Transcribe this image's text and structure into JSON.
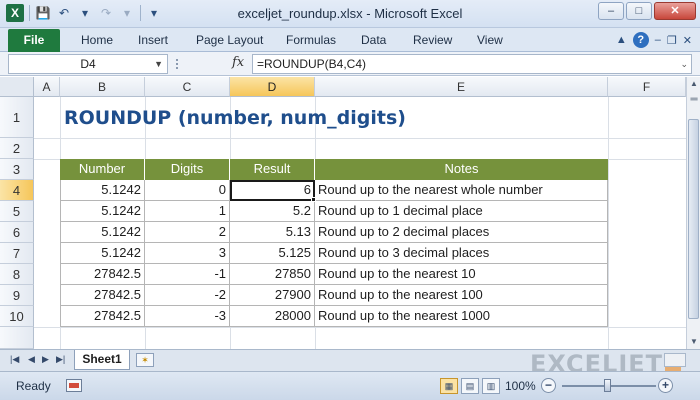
{
  "window": {
    "title": "exceljet_roundup.xlsx - Microsoft Excel",
    "logo": "X",
    "controls": [
      "–",
      "□",
      "✕"
    ]
  },
  "qat": {
    "save_icon": "💾",
    "undo_icon": "↶",
    "redo_icon": "↷",
    "customize_icon": "▾"
  },
  "ribbon": {
    "file_tab": "File",
    "tabs": [
      "Home",
      "Insert",
      "Page Layout",
      "Formulas",
      "Data",
      "Review",
      "View"
    ]
  },
  "formula_bar": {
    "name_box": "D4",
    "fx_label": "fx",
    "formula": "=ROUNDUP(B4,C4)"
  },
  "grid": {
    "columns": [
      "A",
      "B",
      "C",
      "D",
      "E",
      "F"
    ],
    "active_column": "D",
    "rows": [
      "1",
      "2",
      "3",
      "4",
      "5",
      "6",
      "7",
      "8",
      "9",
      "10"
    ],
    "active_row": "4"
  },
  "sheet": {
    "title": "ROUNDUP (number, num_digits)",
    "table": {
      "headers": [
        "Number",
        "Digits",
        "Result",
        "Notes"
      ],
      "rows": [
        [
          "5.1242",
          "0",
          "6",
          "Round up to the nearest whole number"
        ],
        [
          "5.1242",
          "1",
          "5.2",
          "Round up to 1 decimal place"
        ],
        [
          "5.1242",
          "2",
          "5.13",
          "Round up to 2 decimal places"
        ],
        [
          "5.1242",
          "3",
          "5.125",
          "Round up to 3 decimal places"
        ],
        [
          "27842.5",
          "-1",
          "27850",
          "Round up to the nearest 10"
        ],
        [
          "27842.5",
          "-2",
          "27900",
          "Round up to the nearest 100"
        ],
        [
          "27842.5",
          "-3",
          "28000",
          "Round up to the nearest 1000"
        ]
      ]
    },
    "header_color": "#76923c",
    "title_color": "#1f4e8c"
  },
  "sheet_tabs": {
    "active": "Sheet1"
  },
  "watermark": "EXCELJET",
  "status": {
    "ready": "Ready",
    "zoom": "100%"
  }
}
